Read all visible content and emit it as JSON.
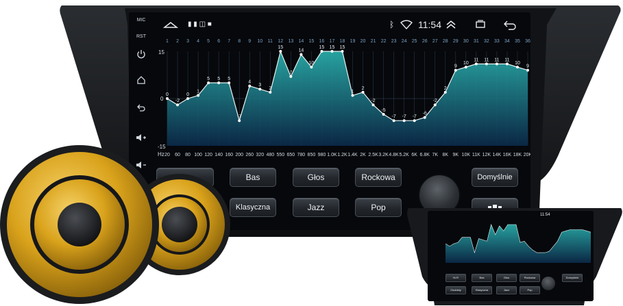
{
  "sidebar": {
    "mic_label": "MIC",
    "rst_label": "RST"
  },
  "statusbar": {
    "time": "11:54",
    "icons": [
      "home-icon",
      "notification-icons",
      "bluetooth-icon",
      "wifi-icon",
      "expand-icon",
      "recents-icon",
      "back-icon"
    ]
  },
  "equalizer": {
    "band_numbers": [
      "1",
      "2",
      "3",
      "4",
      "5",
      "6",
      "7",
      "8",
      "9",
      "10",
      "11",
      "12",
      "13",
      "14",
      "15",
      "16",
      "17",
      "18",
      "19",
      "20",
      "21",
      "22",
      "23",
      "24",
      "25",
      "26",
      "27",
      "28",
      "29",
      "30",
      "31",
      "32",
      "33",
      "34",
      "35",
      "36"
    ],
    "values": [
      0,
      -2,
      0,
      1,
      5,
      5,
      5,
      -7,
      4,
      3,
      2,
      15,
      7,
      14,
      10,
      15,
      15,
      15,
      1,
      2,
      -2,
      -5,
      -7,
      -7,
      -7,
      -6,
      -2,
      2,
      9,
      10,
      11,
      11,
      11,
      11,
      10,
      9
    ],
    "y_max_label": "15",
    "y_zero_label": "0",
    "y_min_label": "-15",
    "freq_unit": "Hz",
    "freq_labels": [
      "20",
      "60",
      "80",
      "100",
      "120",
      "140",
      "160",
      "200",
      "260",
      "320",
      "480",
      "550",
      "650",
      "780",
      "850",
      "980",
      "1.0K",
      "1.2K",
      "1.4K",
      "2K",
      "2.5K",
      "3.2K",
      "4.8K",
      "5.2K",
      "6K",
      "6.8K",
      "7K",
      "8K",
      "9K",
      "10K",
      "11K",
      "12K",
      "14K",
      "16K",
      "18K",
      "20K"
    ]
  },
  "presets": {
    "bas": "Bas",
    "glos": "Głos",
    "rockowa": "Rockowa",
    "domyslnie": "Domyślnie",
    "klasyczna": "Klasyczna",
    "jazz": "Jazz",
    "pop": "Pop"
  },
  "mini_unit": {
    "time": "11:54",
    "buttons": [
      "Hi-Fi",
      "Bas",
      "Głos",
      "Rockowa",
      "Domyślnie",
      "Osobisty",
      "Klasyczna",
      "Jazz",
      "Pop"
    ]
  },
  "colors": {
    "eq_fill_top": "#2bb3b0",
    "eq_fill_bottom": "#0b2a4a",
    "speaker_gold": "#d9a21b",
    "bezel": "#1a1c1f"
  }
}
